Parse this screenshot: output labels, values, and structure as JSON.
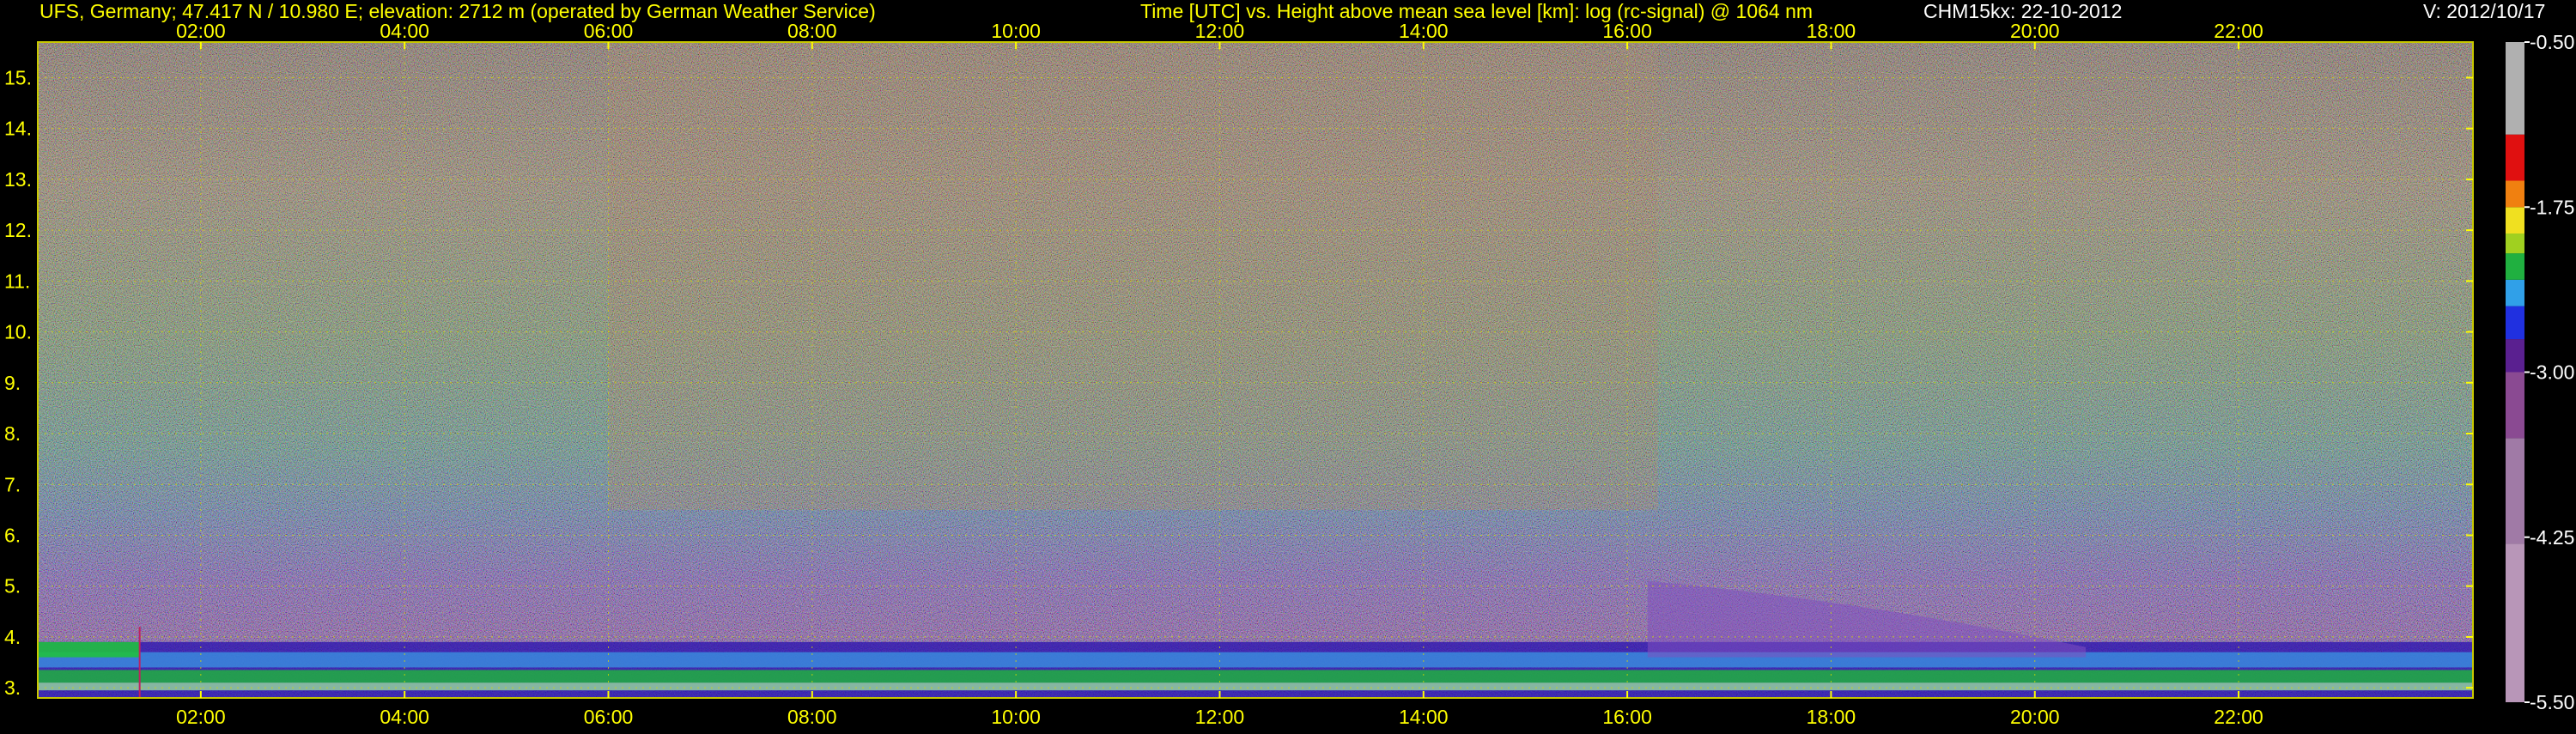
{
  "header": {
    "site_info": "UFS, Germany; 47.417 N / 10.980 E; elevation: 2712 m  (operated by German Weather Service)",
    "axis_description": "Time [UTC] vs. Height above mean sea level [km]: log (rc-signal) @ 1064 nm",
    "instrument_date": "CHM15kx: 22-10-2012",
    "version": "V: 2012/10/17"
  },
  "colors": {
    "text": "#ffff00",
    "grid": "#d8d800",
    "background": "#000000"
  },
  "chart_data": {
    "type": "heatmap",
    "title": "Time [UTC] vs. Height above mean sea level [km]: log (rc-signal) @ 1064 nm",
    "x_ticks": [
      "02:00",
      "04:00",
      "06:00",
      "08:00",
      "10:00",
      "12:00",
      "14:00",
      "16:00",
      "18:00",
      "20:00",
      "22:00"
    ],
    "x_tick_hours": [
      2,
      4,
      6,
      8,
      10,
      12,
      14,
      16,
      18,
      20,
      22
    ],
    "xlim_hours": [
      0.4,
      24.3
    ],
    "y_ticks": [
      "3.",
      "4.",
      "5.",
      "6.",
      "7.",
      "8.",
      "9.",
      "10.",
      "11.",
      "12.",
      "13.",
      "14.",
      "15."
    ],
    "y_tick_values": [
      3,
      4,
      5,
      6,
      7,
      8,
      9,
      10,
      11,
      12,
      13,
      14,
      15
    ],
    "ylim_km": [
      2.8,
      15.7
    ],
    "grid": true,
    "colorbar": {
      "tick_labels": [
        "-0.50",
        "-1.75",
        "-3.00",
        "-4.25",
        "-5.50"
      ],
      "tick_values": [
        -0.5,
        -1.75,
        -3.0,
        -4.25,
        -5.5
      ],
      "range": [
        -5.5,
        -0.5
      ],
      "colors": [
        {
          "value": -5.5,
          "color": "#b896b8"
        },
        {
          "value": -4.3,
          "color": "#a07aa6"
        },
        {
          "value": -3.5,
          "color": "#8a4a92"
        },
        {
          "value": -3.0,
          "color": "#5a2090"
        },
        {
          "value": -2.75,
          "color": "#2030e0"
        },
        {
          "value": -2.5,
          "color": "#30a0e8"
        },
        {
          "value": -2.3,
          "color": "#20b040"
        },
        {
          "value": -2.1,
          "color": "#a0d020"
        },
        {
          "value": -1.95,
          "color": "#f0e020"
        },
        {
          "value": -1.75,
          "color": "#f08010"
        },
        {
          "value": -1.55,
          "color": "#e01010"
        },
        {
          "value": -1.2,
          "color": "#b0b0b0"
        },
        {
          "value": -0.5,
          "color": "#ffffff"
        }
      ]
    },
    "features": [
      {
        "name": "boundary layer",
        "start_hour": 0.4,
        "end_hour": 24.3,
        "top_km_range": [
          3.3,
          3.9
        ]
      },
      {
        "name": "aerosol layer",
        "start_hour": 16.2,
        "end_hour": 20.5,
        "top_km": 5.1
      },
      {
        "name": "data gap/onset",
        "hour": 1.4
      }
    ]
  }
}
